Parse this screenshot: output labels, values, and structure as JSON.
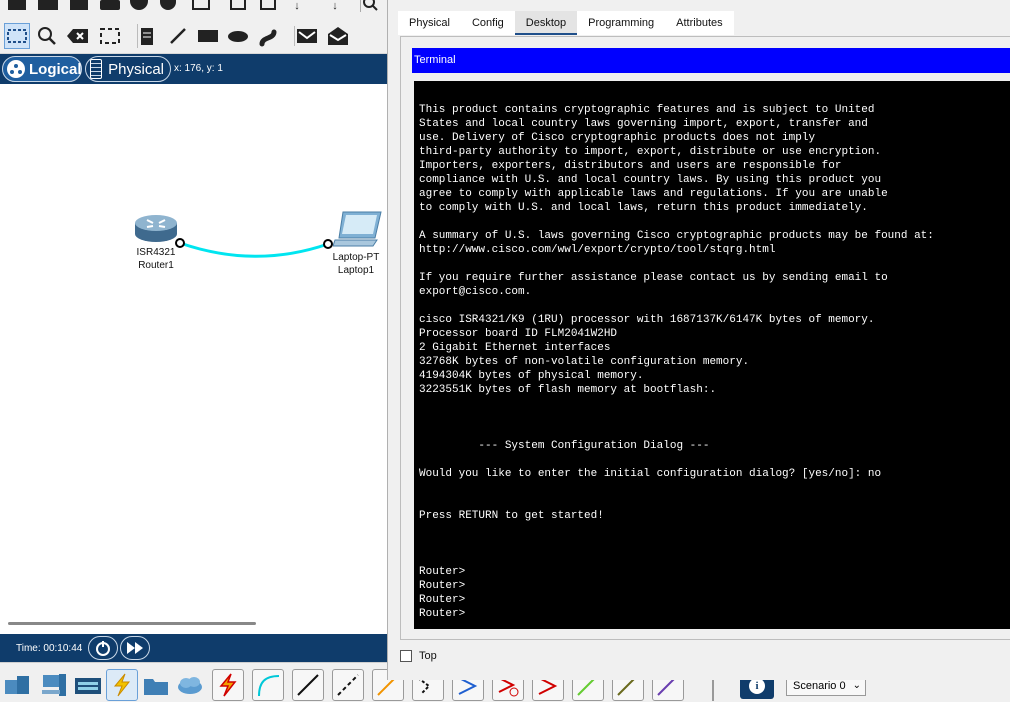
{
  "mode_bar": {
    "logical_label": "Logical",
    "physical_label": "Physical",
    "coords_text": "x: 176, y: 1"
  },
  "devices": {
    "router": {
      "model": "ISR4321",
      "name": "Router1"
    },
    "laptop": {
      "model": "Laptop-PT",
      "name": "Laptop1"
    }
  },
  "time_bar": {
    "time_text": "Time: 00:10:44"
  },
  "window": {
    "tabs": [
      "Physical",
      "Config",
      "Desktop",
      "Programming",
      "Attributes"
    ],
    "active_tab": "Desktop",
    "terminal_title": "Terminal",
    "terminal_lines": [
      "",
      "This product contains cryptographic features and is subject to United",
      "States and local country laws governing import, export, transfer and",
      "use. Delivery of Cisco cryptographic products does not imply",
      "third-party authority to import, export, distribute or use encryption.",
      "Importers, exporters, distributors and users are responsible for",
      "compliance with U.S. and local country laws. By using this product you",
      "agree to comply with applicable laws and regulations. If you are unable",
      "to comply with U.S. and local laws, return this product immediately.",
      "",
      "A summary of U.S. laws governing Cisco cryptographic products may be found at:",
      "http://www.cisco.com/wwl/export/crypto/tool/stqrg.html",
      "",
      "If you require further assistance please contact us by sending email to",
      "export@cisco.com.",
      "",
      "cisco ISR4321/K9 (1RU) processor with 1687137K/6147K bytes of memory.",
      "Processor board ID FLM2041W2HD",
      "2 Gigabit Ethernet interfaces",
      "32768K bytes of non-volatile configuration memory.",
      "4194304K bytes of physical memory.",
      "3223551K bytes of flash memory at bootflash:.",
      "",
      "",
      "",
      "         --- System Configuration Dialog ---",
      "",
      "Would you like to enter the initial configuration dialog? [yes/no]: no",
      "",
      "",
      "Press RETURN to get started!",
      "",
      "",
      "",
      "Router>",
      "Router>",
      "Router>",
      "Router>"
    ],
    "top_checkbox_label": "Top"
  },
  "scenario": {
    "selected": "Scenario 0"
  },
  "colors": {
    "navy": "#0f3c6b",
    "link_cable": "#00e5f0",
    "terminal_title_bg": "#0000ff",
    "terminal_bg": "#000000"
  }
}
